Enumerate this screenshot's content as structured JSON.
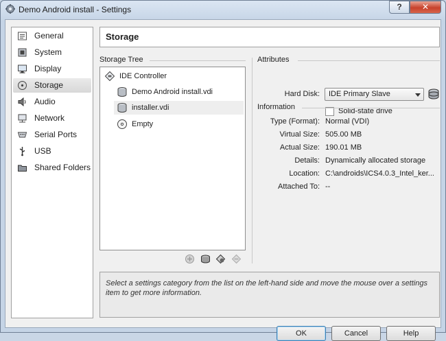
{
  "window": {
    "title": "Demo Android install - Settings",
    "help_glyph": "?",
    "close_glyph": "✕"
  },
  "categories": [
    {
      "label": "General",
      "icon": "general-icon"
    },
    {
      "label": "System",
      "icon": "system-icon"
    },
    {
      "label": "Display",
      "icon": "display-icon"
    },
    {
      "label": "Storage",
      "icon": "storage-icon",
      "selected": true
    },
    {
      "label": "Audio",
      "icon": "audio-icon"
    },
    {
      "label": "Network",
      "icon": "network-icon"
    },
    {
      "label": "Serial Ports",
      "icon": "serial-ports-icon"
    },
    {
      "label": "USB",
      "icon": "usb-icon"
    },
    {
      "label": "Shared Folders",
      "icon": "shared-folders-icon"
    }
  ],
  "page": {
    "title": "Storage"
  },
  "storage_tree": {
    "label": "Storage Tree",
    "controller": "IDE Controller",
    "items": [
      "Demo Android install.vdi",
      "installer.vdi",
      "Empty"
    ],
    "selected_item": "installer.vdi"
  },
  "attributes": {
    "label": "Attributes",
    "hard_disk_label": "Hard Disk:",
    "hard_disk_value": "IDE Primary Slave",
    "solid_state_label": "Solid-state drive",
    "solid_state_checked": false
  },
  "information": {
    "label": "Information",
    "rows": [
      {
        "label": "Type (Format):",
        "value": "Normal (VDI)"
      },
      {
        "label": "Virtual Size:",
        "value": "505.00 MB"
      },
      {
        "label": "Actual Size:",
        "value": "190.01 MB"
      },
      {
        "label": "Details:",
        "value": "Dynamically allocated storage"
      },
      {
        "label": "Location:",
        "value": "C:\\androids\\ICS4.0.3_Intel_ker..."
      },
      {
        "label": "Attached To:",
        "value": "--"
      }
    ]
  },
  "hint": "Select a settings category from the list on the left-hand side and move the mouse over a settings item to get more information.",
  "buttons": {
    "ok": "OK",
    "cancel": "Cancel",
    "help": "Help"
  },
  "colors": {
    "title_bar": "#c5d4e6",
    "close_button": "#c7422c",
    "default_button_border": "#3c7fb1"
  }
}
